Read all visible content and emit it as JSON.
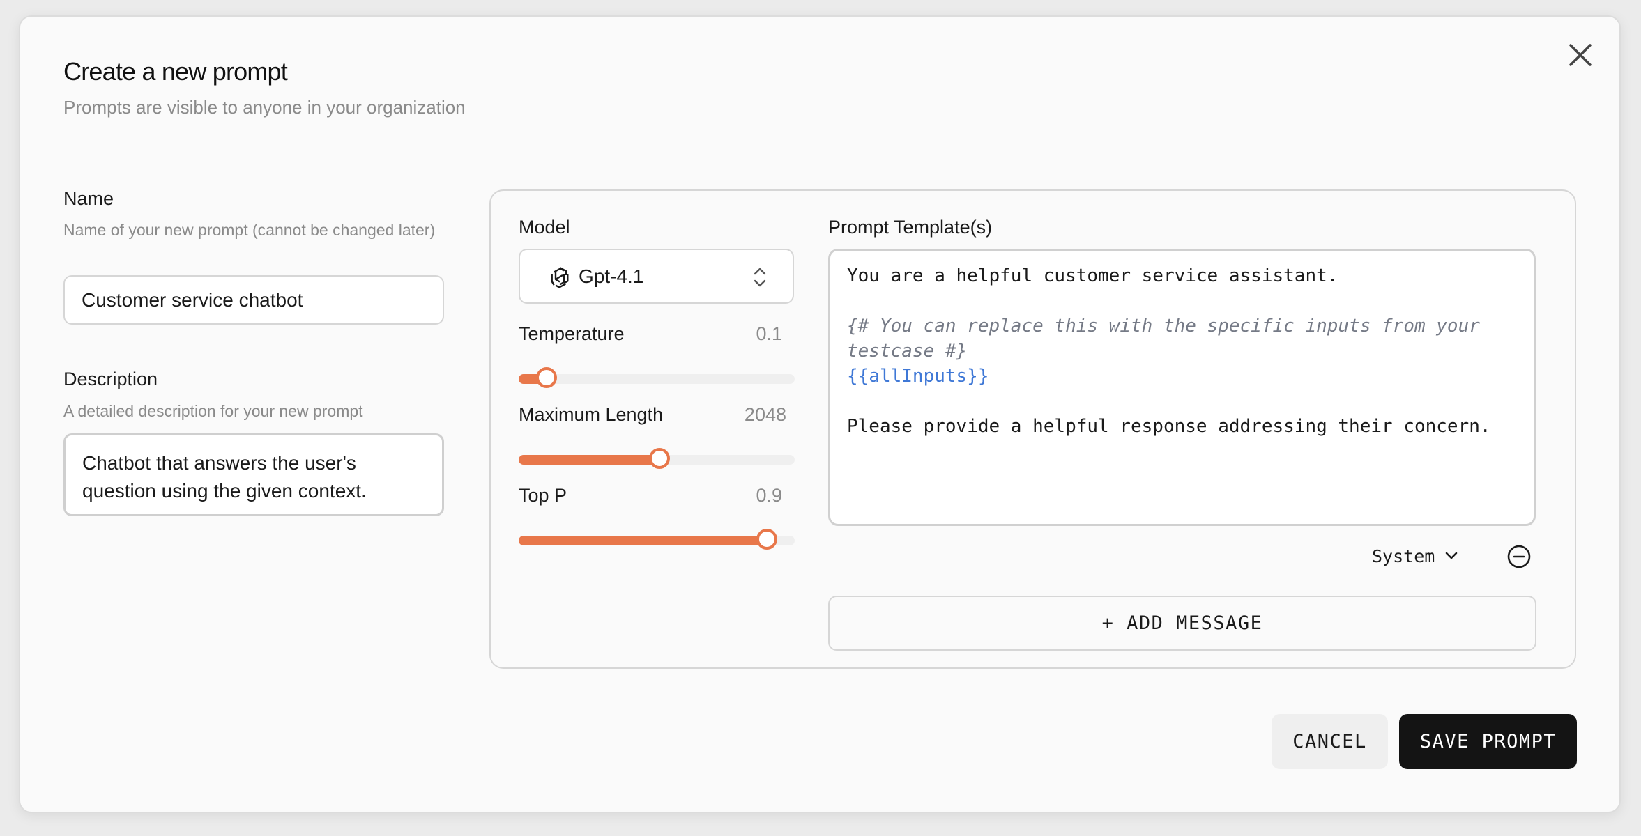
{
  "dialog": {
    "title": "Create a new prompt",
    "subtitle": "Prompts are visible to anyone in your organization",
    "close_icon": "close-icon"
  },
  "name_field": {
    "label": "Name",
    "help": "Name of your new prompt (cannot be changed later)",
    "value": "Customer service chatbot"
  },
  "description_field": {
    "label": "Description",
    "help": "A detailed description for your new prompt",
    "value": "Chatbot that answers the user's question using the given context."
  },
  "model": {
    "label": "Model",
    "selected": "Gpt-4.1",
    "icon": "openai-logo-icon"
  },
  "parameters": {
    "temperature": {
      "label": "Temperature",
      "value": "0.1",
      "fraction": 0.1
    },
    "max_length": {
      "label": "Maximum Length",
      "value": "2048",
      "fraction": 0.51
    },
    "top_p": {
      "label": "Top P",
      "value": "0.9",
      "fraction": 0.9
    }
  },
  "template": {
    "label": "Prompt Template(s)",
    "lines": {
      "l1": "You are a helpful customer service assistant.",
      "l2": "",
      "l3": "{# You can replace this with the specific inputs from your testcase #}",
      "l4": "{{allInputs}}",
      "l5": "",
      "l6": "Please provide a helpful response addressing their concern."
    },
    "role": "System",
    "add_message_label": "+ ADD MESSAGE"
  },
  "footer": {
    "cancel_label": "CANCEL",
    "save_label": "SAVE PROMPT"
  },
  "colors": {
    "accent": "#e8774a",
    "primary_button": "#141414",
    "template_variable": "#3f78d6",
    "template_comment": "#757a86"
  }
}
